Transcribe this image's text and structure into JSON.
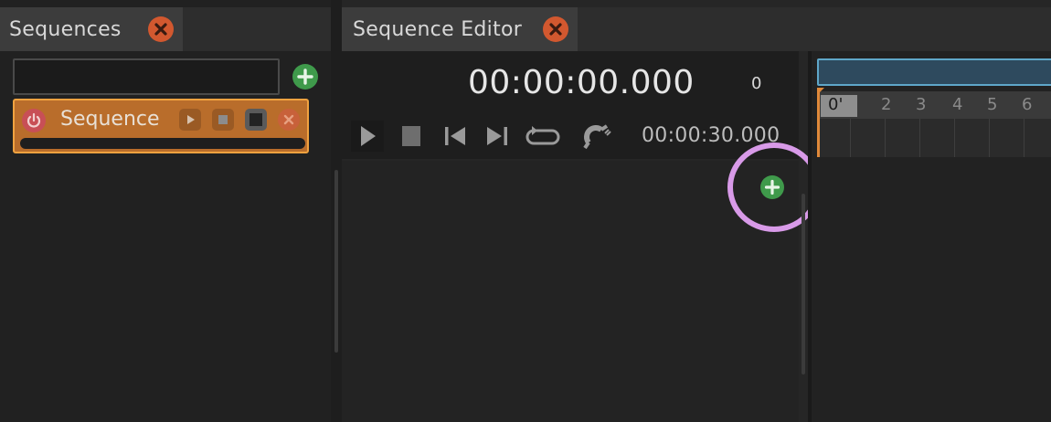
{
  "sequences_panel": {
    "tab_label": "Sequences",
    "search": {
      "value": "",
      "placeholder": ""
    },
    "items": [
      {
        "name": "Sequence",
        "accent": "#b96d2b",
        "border": "#f0a240",
        "progress": 0
      }
    ]
  },
  "editor_panel": {
    "tab_label": "Sequence Editor",
    "current_time": "00:00:00.000",
    "current_frame": "0",
    "total_time": "00:00:30.000",
    "transport": [
      "play-icon",
      "stop-icon",
      "previous-icon",
      "next-icon",
      "loop-icon",
      "snap-magnet-icon"
    ],
    "timeline": {
      "ruler_labels": [
        "0'",
        "2",
        "3",
        "4",
        "5",
        "6"
      ]
    }
  },
  "colors": {
    "close": "#d2582f",
    "add": "#3f9a4b",
    "highlight": "#d89ae8",
    "playhead": "#e0893a",
    "range": "#5fa7c9"
  }
}
